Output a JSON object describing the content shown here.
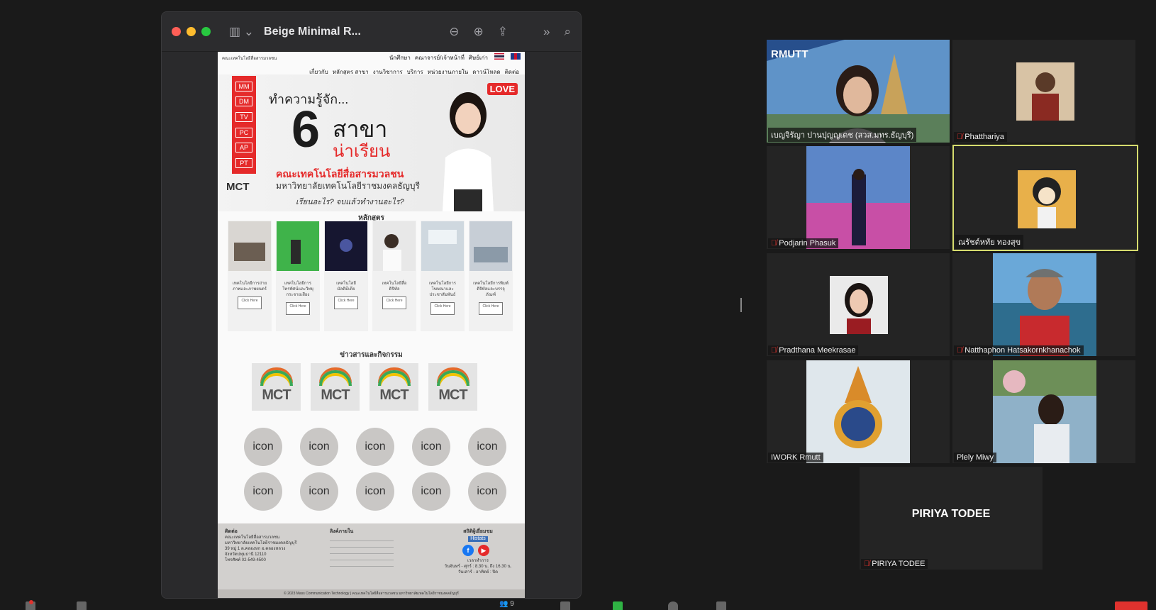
{
  "preview_window": {
    "title": "Beige Minimal R...",
    "toolbar_icons": [
      "sidebar-icon",
      "zoom-out-icon",
      "zoom-in-icon",
      "share-icon",
      "more-icon",
      "search-icon"
    ]
  },
  "document": {
    "top_nav": [
      "นักศึกษา",
      "คณาจารย์/เจ้าหน้าที่",
      "ศิษย์เก่า"
    ],
    "faculty_small": "คณะเทคโนโลยีสื่อสารมวลชน",
    "main_nav": [
      "เกี่ยวกับ",
      "หลักสูตร สาขา",
      "งานวิชาการ",
      "บริการ",
      "หน่วยงานภายใน",
      "ดาวน์โหลด",
      "ติดต่อ"
    ],
    "hero": {
      "tags": [
        "MM",
        "DM",
        "TV",
        "PC",
        "AP",
        "PT"
      ],
      "kicker": "ทำความรู้จัก...",
      "number": "6",
      "line1": "สาขา",
      "line2": "น่าเรียน",
      "faculty": "คณะเทคโนโลยีสื่อสารมวลชน",
      "university": "มหาวิทยาลัยเทคโนโลยีราชมงคลธัญบุรี",
      "question": "เรียนอะไร? จบแล้วทำงานอะไร?",
      "logo": "MCT",
      "badge": "LOVE"
    },
    "courses_title": "หลักสูตร",
    "courses": [
      {
        "name": "เทคโนโลยีการถ่ายภาพและภาพยนตร์",
        "button": "Click Here"
      },
      {
        "name": "เทคโนโลยีการโทรทัศน์และวิทยุกระจายเสียง",
        "button": "Click Here"
      },
      {
        "name": "เทคโนโลยีมัลติมีเดีย",
        "button": "Click Here"
      },
      {
        "name": "เทคโนโลยีสื่อดิจิทัล",
        "button": "Click Here"
      },
      {
        "name": "เทคโนโลยีการโฆษณาและประชาสัมพันธ์",
        "button": "Click Here"
      },
      {
        "name": "เทคโนโลยีการพิมพ์ดิจิทัลและบรรจุภัณฑ์",
        "button": "Click Here"
      }
    ],
    "news_title": "ข่าวสารและกิจกรรม",
    "news": [
      "MCT",
      "MCT",
      "MCT",
      "MCT"
    ],
    "icon_label": "icon",
    "icon_count": 10,
    "footer": {
      "contact_title": "ติดต่อ",
      "contact_lines": [
        "คณะเทคโนโลยีสื่อสารมวลชน",
        "มหาวิทยาลัยเทคโนโลยีราชมงคลธัญบุรี",
        "39 หมู่ 1 ต.คลองหก อ.คลองหลวง",
        "จังหวัดปทุมธานี 12110",
        "โทรศัพท์ 02-549-4500"
      ],
      "links_title": "ลิงค์ภายใน",
      "visitors_title": "สถิติผู้เยี่ยมชม",
      "visitors_badge": "Histats",
      "hours_title": "เวลาทำการ",
      "hours_lines": [
        "วันจันทร์ - ศุกร์ : 8.30 น. ถึง 16.30 น.",
        "วันเสาร์ - อาทิตย์ : ปิด"
      ],
      "copyright": "© 2023 Mass Communication Technology | คณะเทคโนโลยีสื่อสารมวลชน มหาวิทยาลัยเทคโนโลยีราชมงคลธัญบุรี"
    }
  },
  "participants": [
    {
      "name": "เบญจิรัญา ปานปุญญเดช (สวส.มทร.ธัญบุรี)",
      "muted": false,
      "banner": "RMUTT"
    },
    {
      "name": "Phatthariya",
      "muted": true
    },
    {
      "name": "Podjarin Phasuk",
      "muted": true
    },
    {
      "name": "ณรัชต์หทัย ทองสุข",
      "muted": false,
      "active": true
    },
    {
      "name": "Pradthana Meekrasae",
      "muted": true
    },
    {
      "name": "Natthaphon Hatsakornkhanachok",
      "muted": true
    },
    {
      "name": "IWORK Rmutt",
      "muted": false
    },
    {
      "name": "Plely Miwy",
      "muted": false
    },
    {
      "name": "PIRIYA TODEE",
      "muted": true,
      "display_name": "PIRIYA TODEE"
    }
  ],
  "toolbar": {
    "participants_count": "9"
  },
  "colors": {
    "accent_red": "#e52a2a",
    "active_speaker": "#d6dc6e",
    "zoom_bg": "#1a1a1a"
  }
}
